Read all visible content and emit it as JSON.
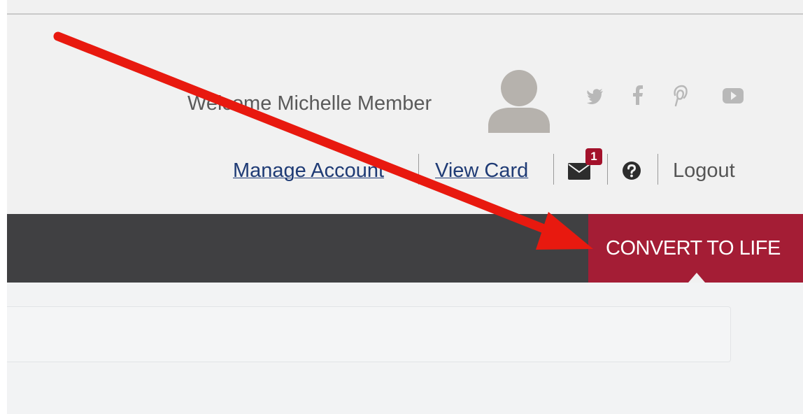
{
  "header": {
    "welcome_text": "Welcome Michelle Member",
    "social_icons": [
      "twitter-icon",
      "facebook-icon",
      "pinterest-icon",
      "youtube-icon"
    ],
    "social_icon_color": "#b8b8b8"
  },
  "account_links": {
    "manage_account": "Manage Account",
    "view_card": "View Card",
    "messages_badge": "1",
    "logout": "Logout"
  },
  "nav": {
    "convert_button": "CONVERT TO LIFE",
    "bar_color": "#404042",
    "accent_color": "#a41d35"
  },
  "annotation": {
    "arrow_color": "#e8190f"
  }
}
